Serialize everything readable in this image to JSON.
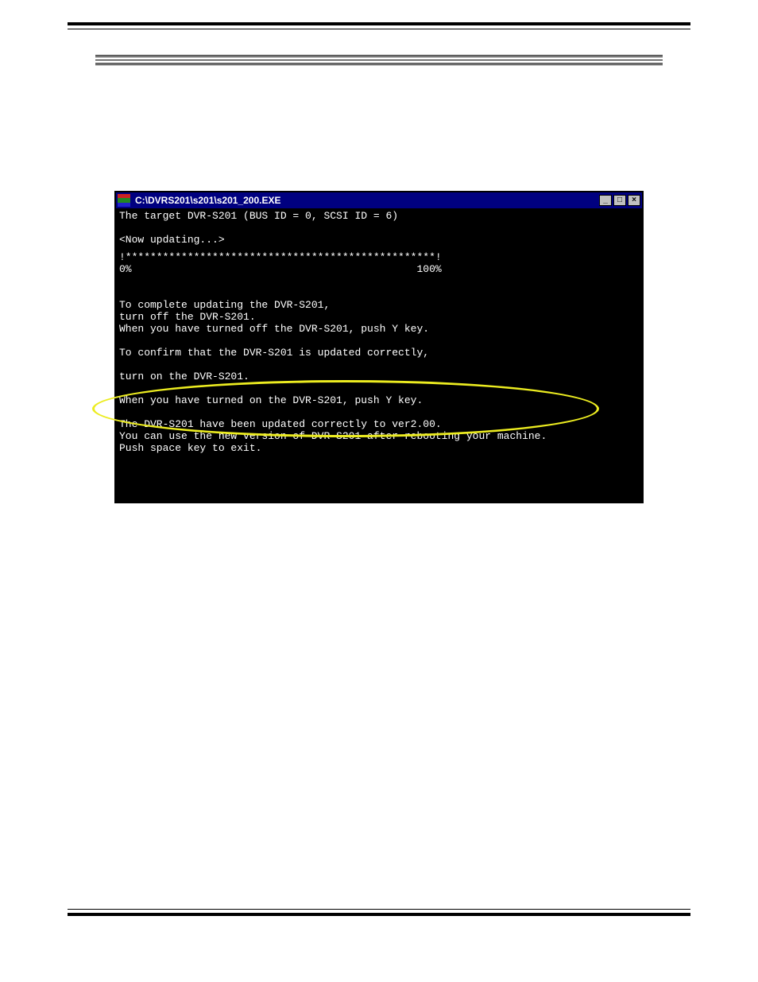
{
  "window": {
    "title": "C:\\DVRS201\\s201\\s201_200.EXE",
    "buttons": {
      "minimize": "_",
      "maximize": "□",
      "close": "×"
    }
  },
  "terminal": {
    "lines": [
      "The target DVR-S201 (BUS ID = 0, SCSI ID = 6)",
      "",
      "<Now updating...>",
      "",
      "!**************************************************!",
      "0%                                              100%",
      "",
      "",
      "To complete updating the DVR-S201,",
      "turn off the DVR-S201.",
      "When you have turned off the DVR-S201, push Y key.",
      "",
      "To confirm that the DVR-S201 is updated correctly,",
      "",
      "turn on the DVR-S201.",
      "",
      "When you have turned on the DVR-S201, push Y key.",
      "",
      "The DVR-S201 have been updated correctly to ver2.00.",
      "You can use the new version of DVR-S201 after rebooting your machine.",
      "Push space key to exit."
    ]
  },
  "highlight_note": "updated-correctly-message"
}
